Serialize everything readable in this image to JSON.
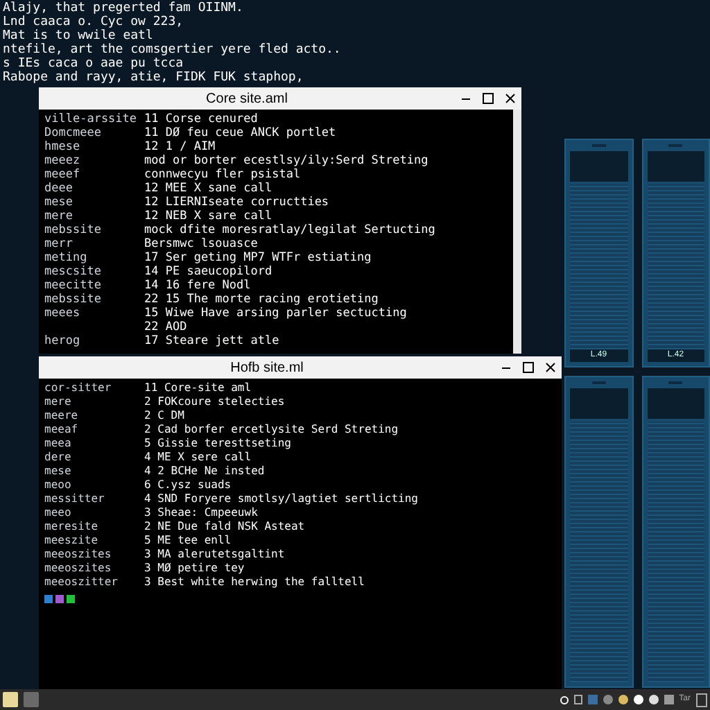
{
  "terminal_lines": [
    "Alajy, that pregerted fam OIINM.",
    "Lnd caaca o. Cyc ow 223,",
    "Mat is to wwile eatl",
    "ntefile, art the comsgertier yere fled acto..",
    "s IEs caca o aae pu  tcca",
    "Rabope and rayy, atie, FIDK FUK staphop,"
  ],
  "windows": [
    {
      "title": "Core site.aml",
      "scrollbar": true,
      "rows": [
        {
          "name": "ville-arssite",
          "text": "11 Corse cenured"
        },
        {
          "name": "Domcmeee",
          "text": "11 DØ feu ceue ANCK portlet"
        },
        {
          "name": "hmese",
          "text": "12 1 / AIM"
        },
        {
          "name": "meeez",
          "text": "mod or borter ecestlsy/ily:Serd Streting"
        },
        {
          "name": "meeef",
          "text": "connwecyu fler  psistal"
        },
        {
          "name": "deee",
          "text": "12 MEE X sane call"
        },
        {
          "name": "mese",
          "text": "12 LIERNIseate corructties"
        },
        {
          "name": "mere",
          "text": "12 NEB X sare call"
        },
        {
          "name": "mebssite",
          "text": "mock dfite moresratlay/legilat Sertucting"
        },
        {
          "name": "merr",
          "text": "Bersmwc   lsouasce"
        },
        {
          "name": "meting",
          "text": "17 Ser geting MP7 WTFr estiating"
        },
        {
          "name": "mescsite",
          "text": "14 PE saeucopilord"
        },
        {
          "name": "meecitte",
          "text": "14 16 fere Nodl"
        },
        {
          "name": "mebssite",
          "text": "22 15 The morte racing erotieting"
        },
        {
          "name": "meees",
          "text": "15 Wiwe Have arsing parler sectucting"
        },
        {
          "text": "22 AOD"
        },
        {
          "name": "herog",
          "text": "17 Steare jett atle"
        }
      ]
    },
    {
      "title": "Hofb site.ml",
      "scrollbar": false,
      "rows": [
        {
          "name": "cor-sitter",
          "text": "11 Core-site aml"
        },
        {
          "name": "mere",
          "text": "2 FOKcoure stelecties"
        },
        {
          "name": "meere",
          "text": "2 C DM"
        },
        {
          "name": "meeaf",
          "text": "2 Cad borfer ercetlysite Serd Streting"
        },
        {
          "name": "meea",
          "text": "5 Gissie teresttseting"
        },
        {
          "name": "dere",
          "text": "4 ME X sere call"
        },
        {
          "name": "mese",
          "text": "4 2 BCHe Ne insted"
        },
        {
          "name": "meoo",
          "text": "6 C.ysz suads"
        },
        {
          "name": "messitter",
          "text": "4 SND Foryere smotlsy/lagtiet sertlicting"
        },
        {
          "name": "meeo",
          "text": "3 Sheae:   Cmpeeuwk"
        },
        {
          "name": "meresite",
          "text": "2 NE Due fald NSK Asteat"
        },
        {
          "name": "meeszite",
          "text": "5 ME tee enll"
        },
        {
          "name": "meeoszites",
          "text": "3 MA alerutetsgaltint"
        },
        {
          "name": "meeoszites",
          "text": "3 MØ petire tey"
        },
        {
          "name": "meeoszitter",
          "text": "3 Best white herwing the falltell"
        }
      ],
      "swatches": [
        {
          "color": "#2f7fd0"
        },
        {
          "color": "#a05ad0"
        },
        {
          "color": "#22c03a"
        }
      ]
    }
  ],
  "racks": [
    {
      "label": "L.49"
    },
    {
      "label": "L.42"
    }
  ],
  "taskbar": {
    "clock": "Tar"
  }
}
